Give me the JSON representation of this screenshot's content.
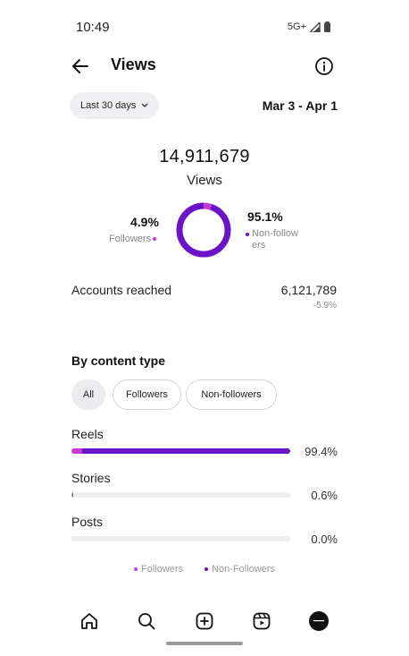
{
  "status": {
    "time": "10:49",
    "network": "5G+"
  },
  "header": {
    "title": "Views"
  },
  "filter": {
    "range_label": "Last 30 days",
    "date_range": "Mar 3 - Apr 1"
  },
  "summary": {
    "total": "14,911,679",
    "total_label": "Views",
    "followers_pct": "4.9%",
    "followers_label": "Followers",
    "nonfollowers_pct": "95.1%",
    "nonfollowers_label": "Non-follow ers"
  },
  "reach": {
    "label": "Accounts reached",
    "value": "6,121,789",
    "change": "-5.9%"
  },
  "content_type": {
    "title": "By content type",
    "chips": [
      "All",
      "Followers",
      "Non-followers"
    ],
    "selected_chip": "All",
    "rows": [
      {
        "label": "Reels",
        "pct": "99.4%",
        "followers_fraction": 0.05,
        "total_fraction": 1.0
      },
      {
        "label": "Stories",
        "pct": "0.6%",
        "followers_fraction": 0.0,
        "total_fraction": 0.006
      },
      {
        "label": "Posts",
        "pct": "0.0%",
        "followers_fraction": 0.0,
        "total_fraction": 0.0
      }
    ]
  },
  "legend": {
    "followers": "Followers",
    "nonfollowers": "Non-Followers"
  },
  "colors": {
    "followers": "#c43bd1",
    "nonfollowers": "#6b14c7"
  },
  "chart_data": {
    "type": "pie",
    "categories": [
      "Followers",
      "Non-followers"
    ],
    "values": [
      4.9,
      95.1
    ]
  },
  "nav": {
    "items": [
      "home-icon",
      "search-icon",
      "create-icon",
      "reels-icon",
      "profile-avatar"
    ]
  }
}
